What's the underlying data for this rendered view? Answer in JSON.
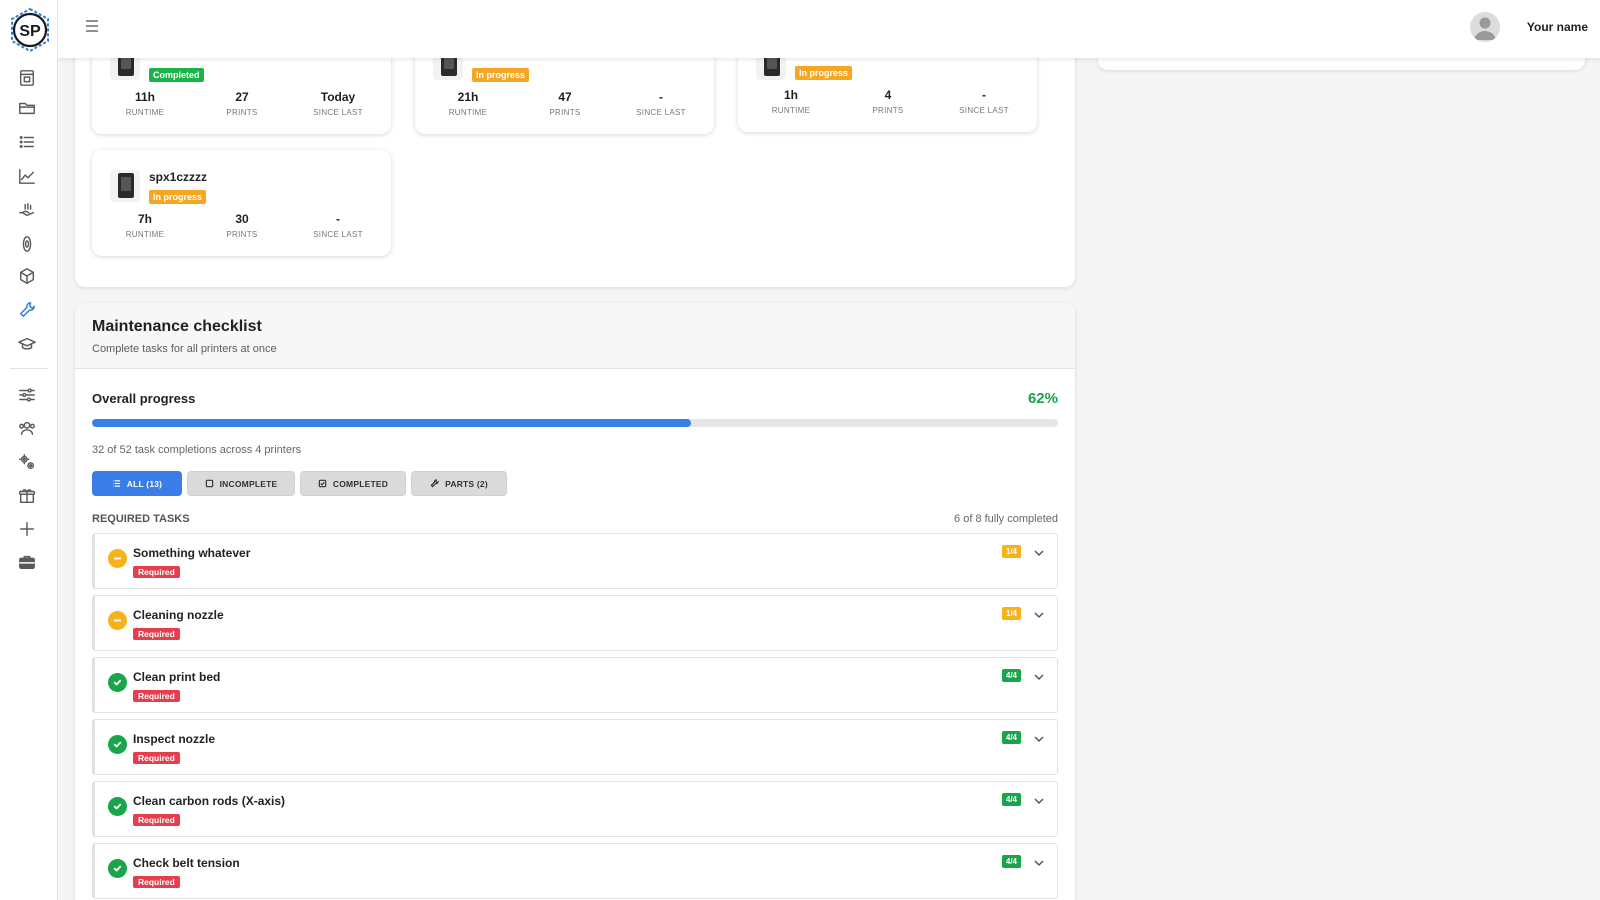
{
  "brand": {
    "logo_text": "SP",
    "accent": "#2d7fd3"
  },
  "sidebar": {
    "items": [
      {
        "icon": "printer-icon"
      },
      {
        "icon": "folder-icon"
      },
      {
        "icon": "list-icon"
      },
      {
        "icon": "chart-icon"
      },
      {
        "icon": "hand-icon"
      },
      {
        "icon": "filament-icon"
      },
      {
        "icon": "cube-icon"
      },
      {
        "icon": "wrench-icon",
        "active": true
      },
      {
        "icon": "graduation-cap-icon"
      },
      {
        "icon": "sliders-icon"
      },
      {
        "icon": "users-icon"
      },
      {
        "icon": "gears-icon"
      },
      {
        "icon": "gift-icon"
      },
      {
        "icon": "plus-icon"
      },
      {
        "icon": "briefcase-icon"
      }
    ]
  },
  "topbar": {
    "user_name": "Your name"
  },
  "printers": [
    {
      "name": "",
      "status": "Completed",
      "runtime": "11h",
      "prints": "27",
      "since_last": "Today"
    },
    {
      "name": "",
      "status": "In progress",
      "runtime": "21h",
      "prints": "47",
      "since_last": "-"
    },
    {
      "name": "",
      "status": "In progress",
      "runtime": "1h",
      "prints": "4",
      "since_last": "-"
    },
    {
      "name": "spx1czzzz",
      "status": "In progress",
      "runtime": "7h",
      "prints": "30",
      "since_last": "-"
    }
  ],
  "stat_labels": {
    "runtime": "RUNTIME",
    "prints": "PRINTS",
    "since_last": "SINCE LAST"
  },
  "checklist": {
    "title": "Maintenance checklist",
    "subtitle": "Complete tasks for all printers at once",
    "overall_label": "Overall progress",
    "overall_pct": "62%",
    "progress_fraction": 0.62,
    "summary": "32 of 52 task completions across 4 printers",
    "filters": [
      {
        "label": "ALL (13)",
        "active": true
      },
      {
        "label": "INCOMPLETE",
        "active": false
      },
      {
        "label": "COMPLETED",
        "active": false
      },
      {
        "label": "PARTS (2)",
        "active": false
      }
    ],
    "required_label": "REQUIRED TASKS",
    "required_count": "6 of 8 fully completed",
    "tasks": [
      {
        "name": "Something whatever",
        "tag": "Required",
        "count": "1/4",
        "state": "partial"
      },
      {
        "name": "Cleaning nozzle",
        "tag": "Required",
        "count": "1/4",
        "state": "partial"
      },
      {
        "name": "Clean print bed",
        "tag": "Required",
        "count": "4/4",
        "state": "done"
      },
      {
        "name": "Inspect nozzle",
        "tag": "Required",
        "count": "4/4",
        "state": "done"
      },
      {
        "name": "Clean carbon rods (X-axis)",
        "tag": "Required",
        "count": "4/4",
        "state": "done"
      },
      {
        "name": "Check belt tension",
        "tag": "Required",
        "count": "4/4",
        "state": "done"
      }
    ]
  },
  "colors": {
    "completed": "#19b34a",
    "in_progress": "#f5a623",
    "required": "#e53e4d",
    "progress_blue": "#3a7de6",
    "progress_green_text": "#19a14a"
  }
}
